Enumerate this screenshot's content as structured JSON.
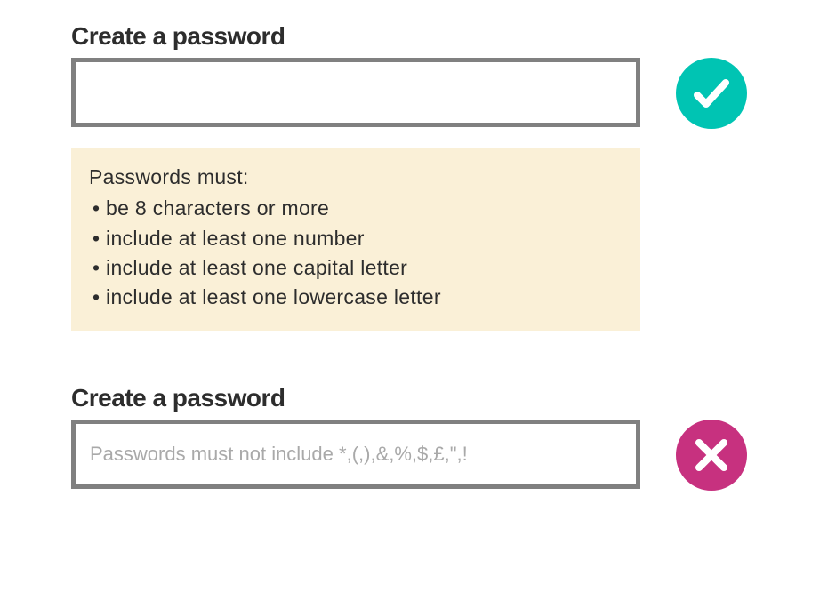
{
  "good": {
    "label": "Create a password",
    "hint_title": "Passwords must:",
    "hint_items": [
      "• be 8 characters or more",
      "• include at least one number",
      "• include at least one capital letter",
      "• include at least one lowercase letter"
    ]
  },
  "bad": {
    "label": "Create a password",
    "placeholder": "Passwords must not include *,(,),&,%,$,£,\",!"
  }
}
